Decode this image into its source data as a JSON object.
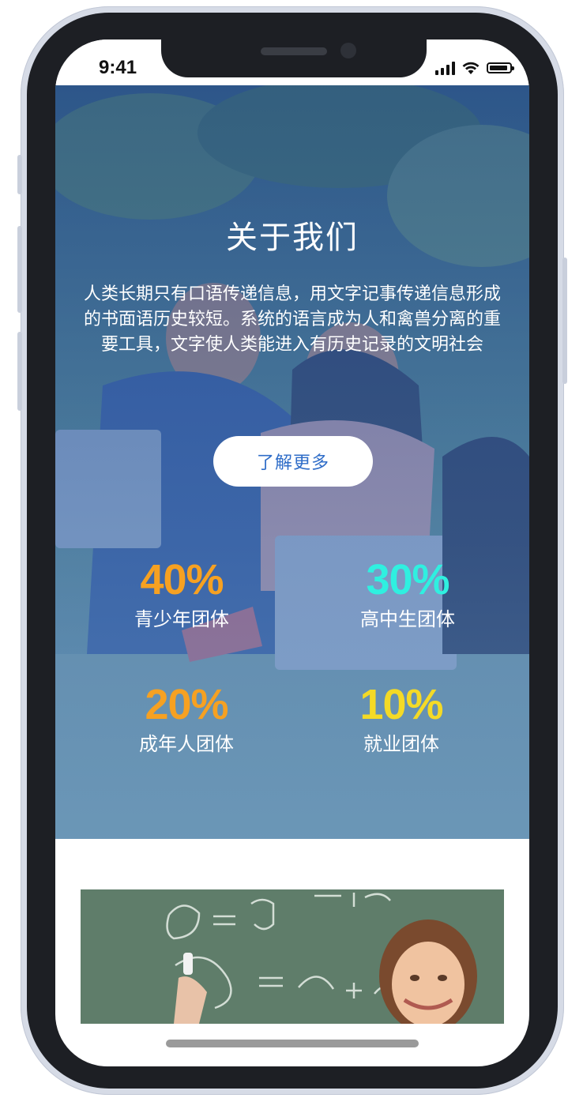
{
  "status_bar": {
    "time": "9:41"
  },
  "hero": {
    "title": "关于我们",
    "description": "人类长期只有口语传递信息，用文字记事传递信息形成的书面语历史较短。系统的语言成为人和禽兽分离的重要工具，文字使人类能进入有历史记录的文明社会",
    "button_label": "了解更多",
    "stats": [
      {
        "value": "40%",
        "label": "青少年团体",
        "color": "#f6a122"
      },
      {
        "value": "30%",
        "label": "高中生团体",
        "color": "#2ff0e0"
      },
      {
        "value": "20%",
        "label": "成年人团体",
        "color": "#f6a122"
      },
      {
        "value": "10%",
        "label": "就业团体",
        "color": "#f4da26"
      }
    ]
  },
  "colors": {
    "button_text": "#2f6dc8",
    "hero_overlay": "#2a5cb0"
  }
}
